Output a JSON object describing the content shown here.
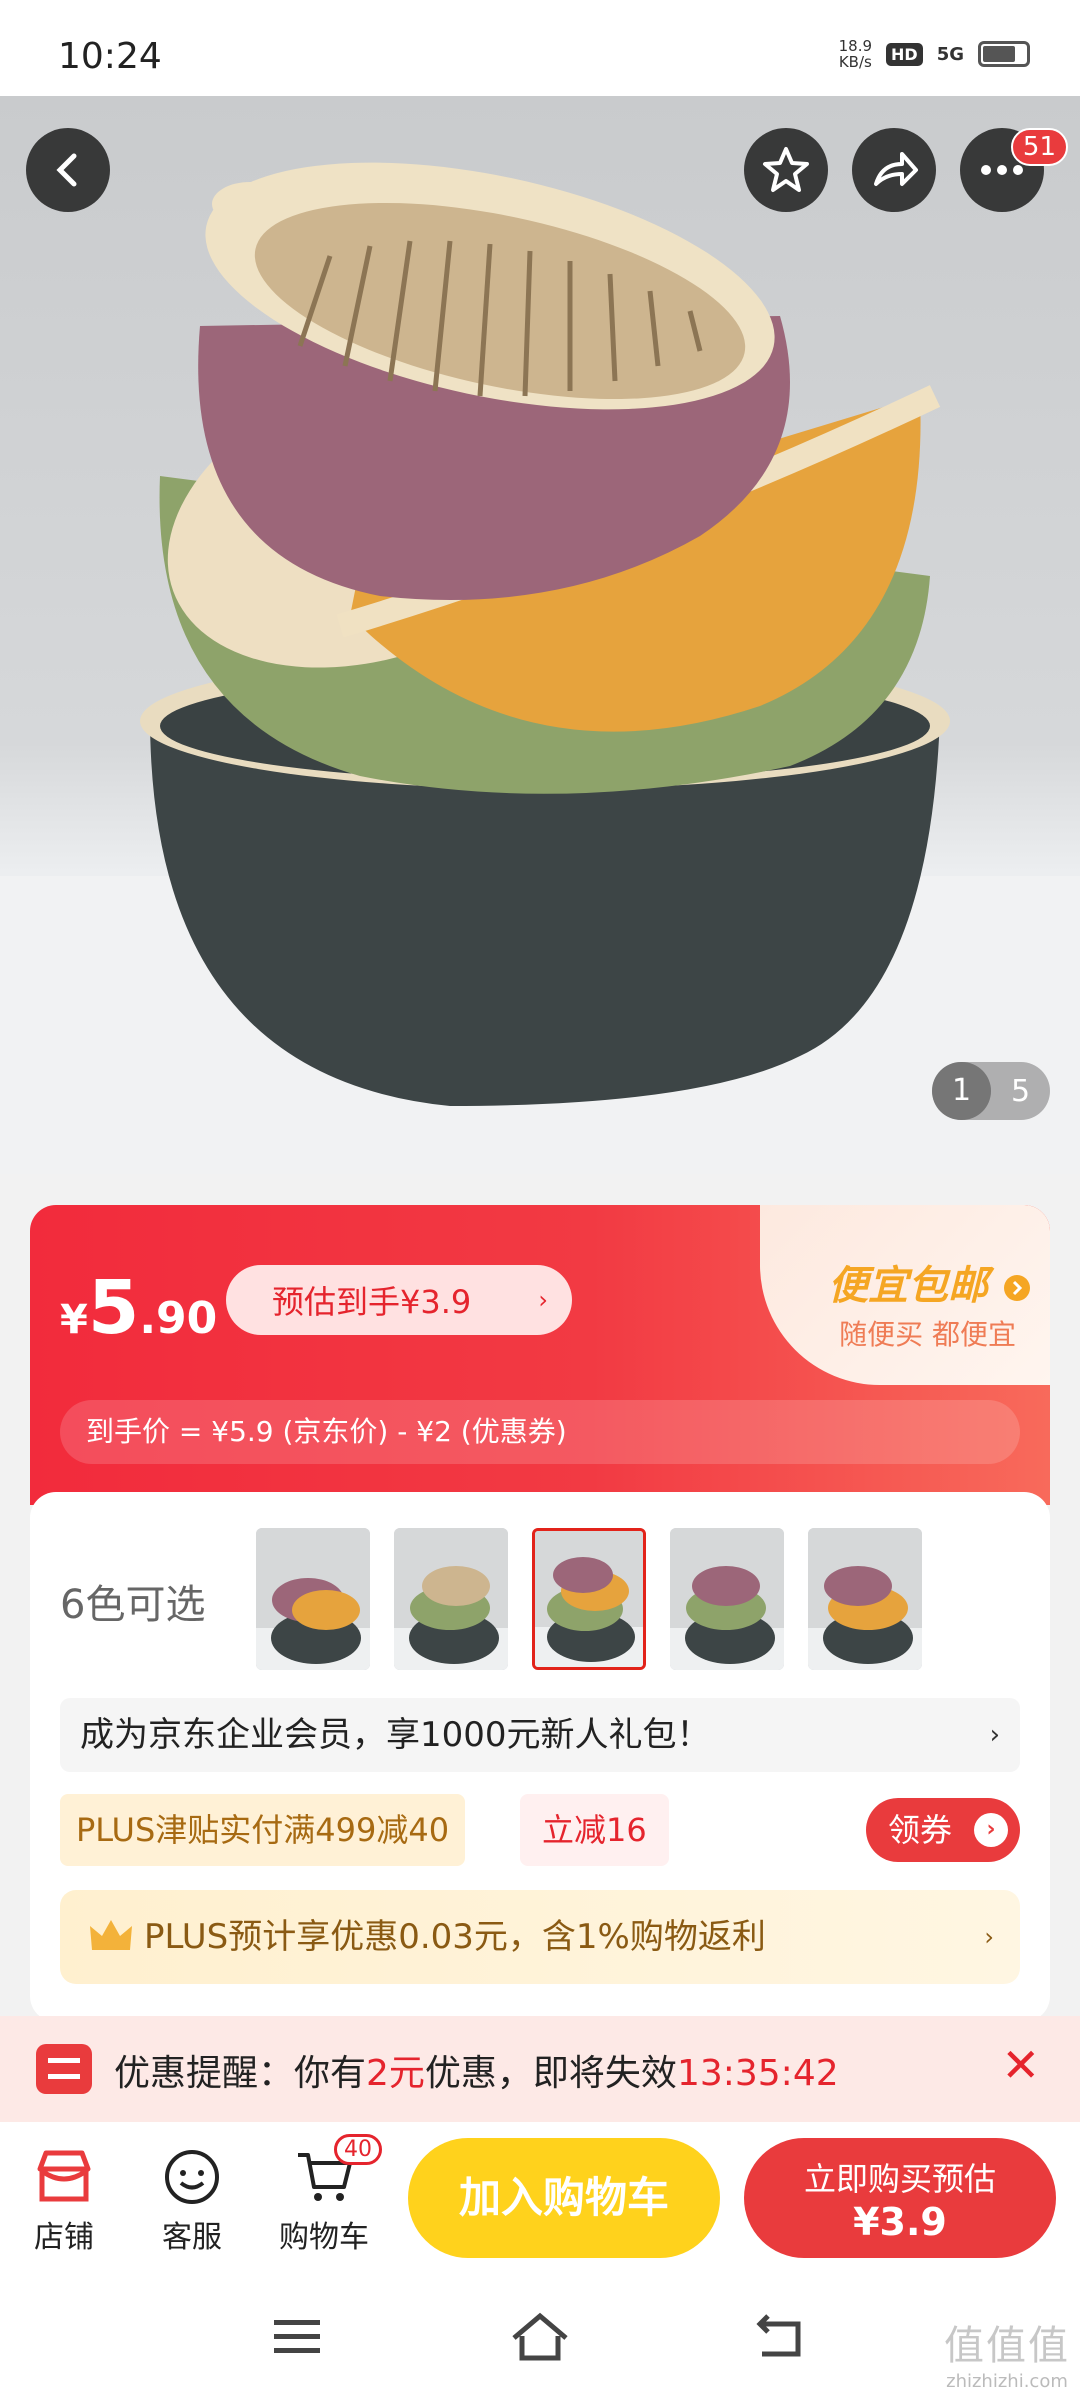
{
  "status_bar": {
    "time": "10:24",
    "net_speed_value": "18.9",
    "net_speed_unit": "KB/s",
    "hd_label": "HD",
    "signal_label": "5G"
  },
  "hero": {
    "notification_count": "51",
    "pager_current": "1",
    "pager_total": "5"
  },
  "price": {
    "currency": "¥",
    "integer": "5",
    "decimal": ".90",
    "estimate_label": "预估到手¥3.9",
    "estimate_chevron": "›",
    "promo_title": "便宜包邮",
    "promo_subtitle": "随便买 都便宜",
    "calculation": "到手价 = ¥5.9 (京东价) - ¥2 (优惠券)"
  },
  "colors": {
    "label": "6色可选",
    "selected_index": 2
  },
  "member": {
    "text": "成为京东企业会员，享1000元新人礼包！",
    "chevron": "›"
  },
  "tags": {
    "plus": "PLUS津贴实付满499减40",
    "cut": "立减16",
    "coupon_button": "领券"
  },
  "plus_bar": {
    "text": "PLUS预计享优惠0.03元，含1%购物返利",
    "chevron": "›"
  },
  "reminder": {
    "prefix": "优惠提醒：你有",
    "amount": "2元",
    "middle": "优惠，即将失效",
    "countdown": "13:35:42",
    "close": "✕"
  },
  "actions": {
    "store": "店铺",
    "service": "客服",
    "cart": "购物车",
    "cart_count": "40",
    "add_to_cart": "加入购物车",
    "buy_now_line1": "立即购买预估",
    "buy_now_line2": "¥3.9"
  },
  "watermark": {
    "text": "值值值",
    "domain": "zhizhizhi.com"
  },
  "colors_theme": {
    "accent_red": "#e93b3d",
    "accent_yellow": "#ffd21c"
  }
}
